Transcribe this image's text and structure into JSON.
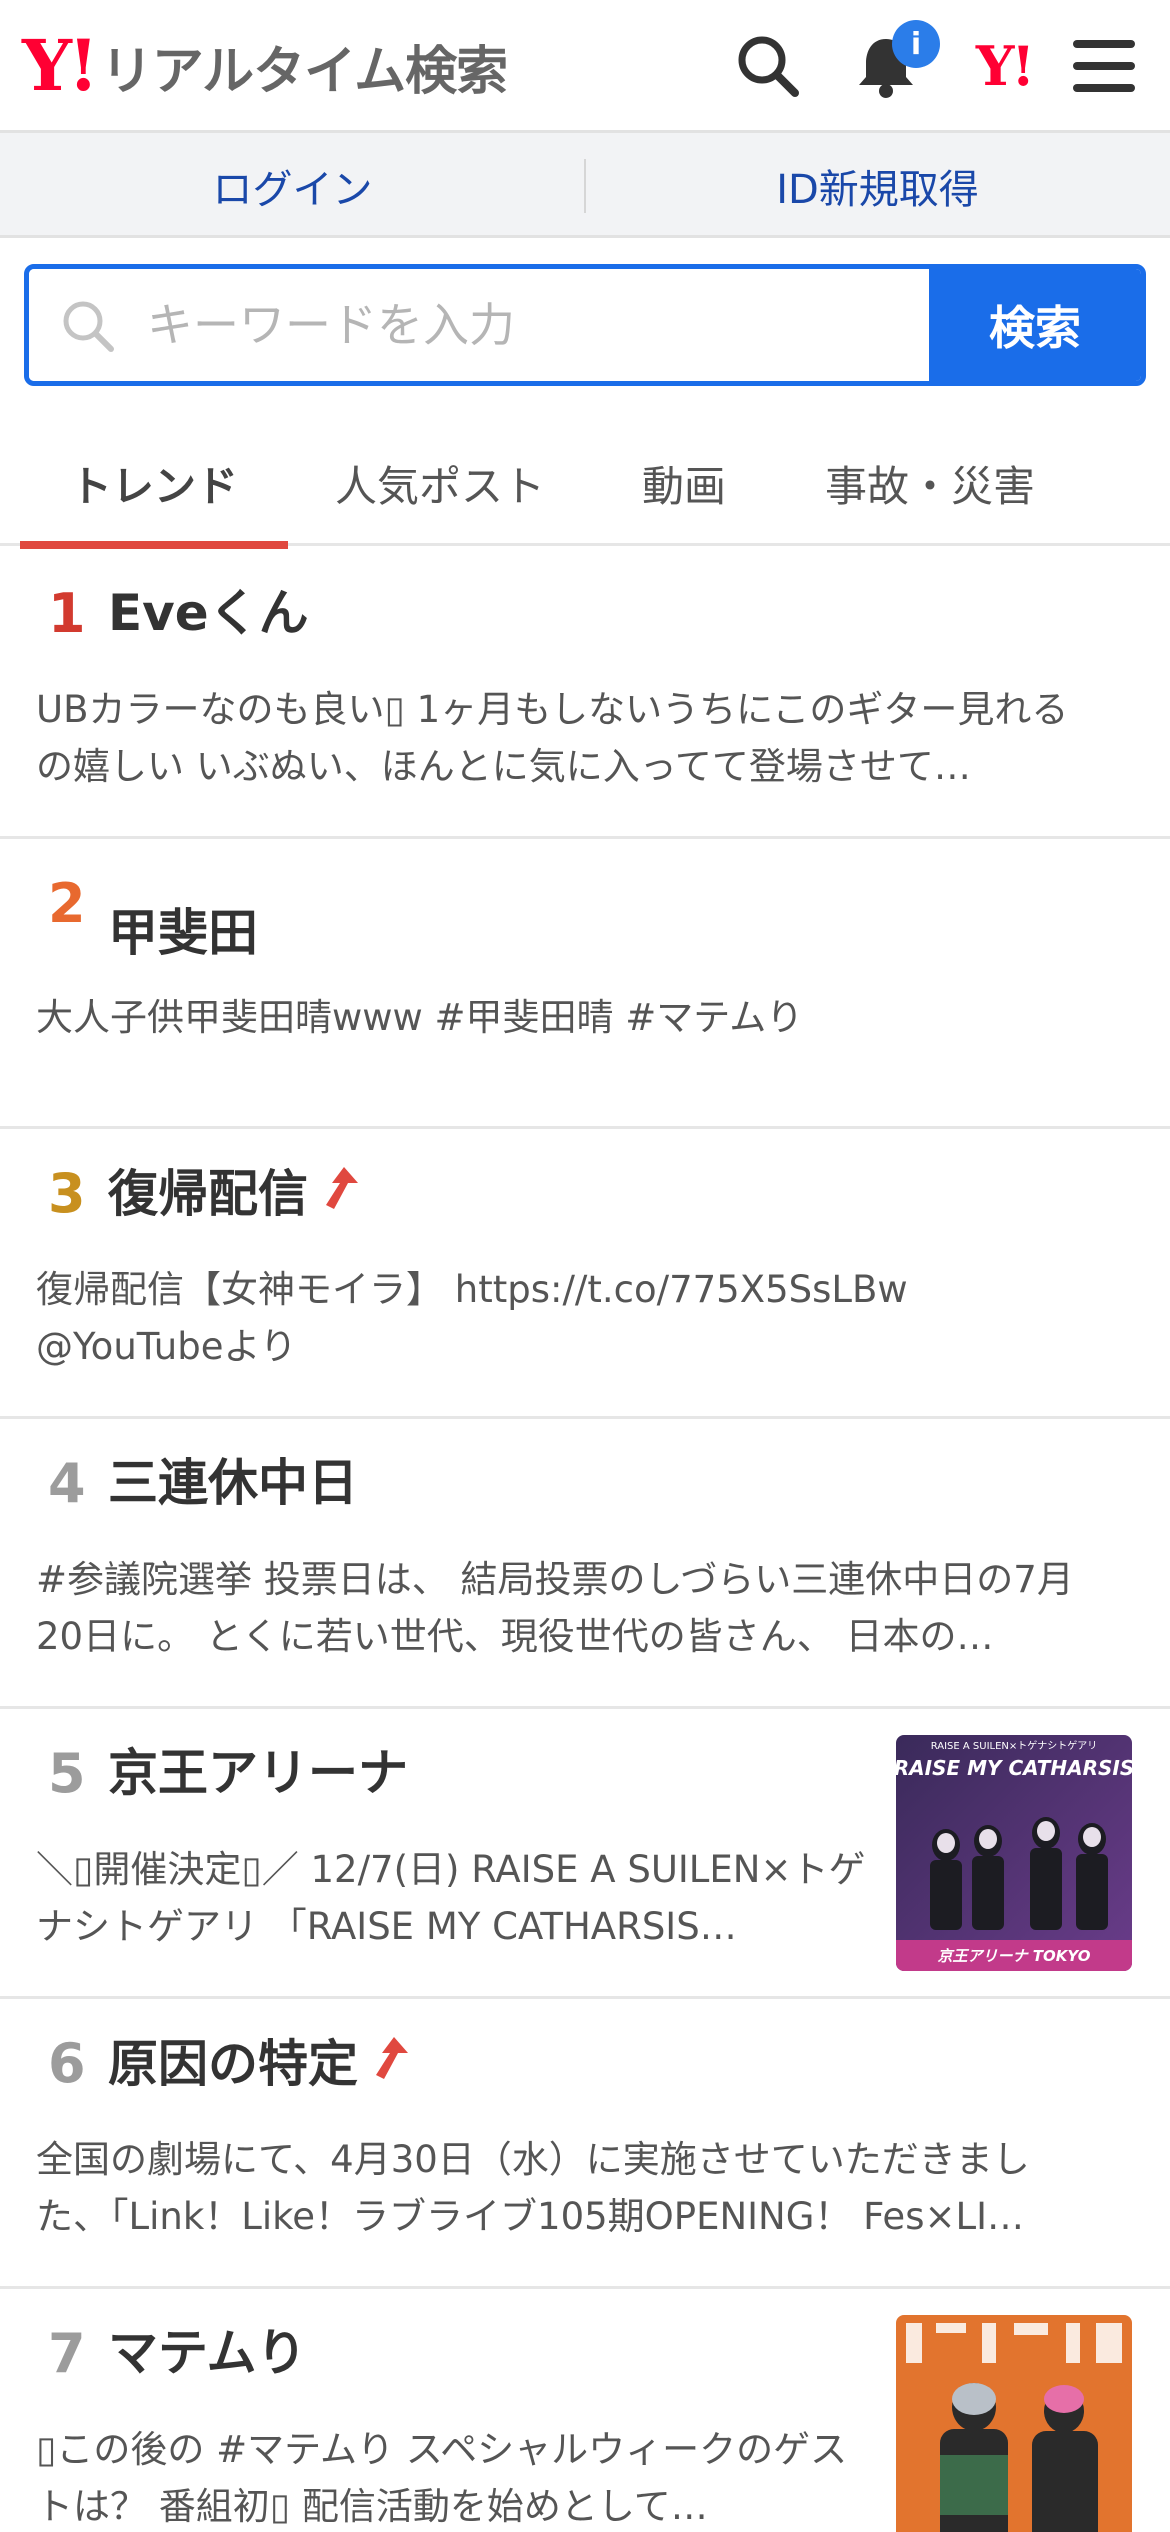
{
  "header": {
    "logo_mark": "Y!",
    "logo_text": "リアルタイム検索",
    "notification_count": "i",
    "yj_mark": "Y!"
  },
  "loginbar": {
    "login_label": "ログイン",
    "register_label": "ID新規取得"
  },
  "search": {
    "placeholder": "キーワードを入力",
    "button_label": "検索"
  },
  "tabs": [
    {
      "label": "トレンド",
      "active": true
    },
    {
      "label": "人気ポスト",
      "active": false
    },
    {
      "label": "動画",
      "active": false
    },
    {
      "label": "事故・災害",
      "active": false
    }
  ],
  "trends": [
    {
      "rank": "1",
      "term": "Eveくん",
      "rising": false,
      "has_thumb": false,
      "desc": "UBカラーなのも良い▯ 1ヶ月もしないうちにこのギター見れるの嬉しい いぶぬい、ほんとに気に入ってて登場させて…"
    },
    {
      "rank": "2",
      "term": "甲斐田",
      "rising": false,
      "has_thumb": false,
      "desc": "大人子供甲斐田晴www #甲斐田晴 #マテムり"
    },
    {
      "rank": "3",
      "term": "復帰配信",
      "rising": true,
      "has_thumb": false,
      "desc": "復帰配信【女神モイラ】 https://t.co/775X5SsLBw @YouTubeより"
    },
    {
      "rank": "4",
      "term": "三連休中日",
      "rising": false,
      "has_thumb": false,
      "desc": "#参議院選挙 投票日は、 結局投票のしづらい三連休中日の7月20日に。 とくに若い世代、現役世代の皆さん、 日本の…"
    },
    {
      "rank": "5",
      "term": "京王アリーナ",
      "rising": false,
      "has_thumb": true,
      "desc": "＼▯開催決定▯／ 12/7(日) RAISE A SUILEN×トゲナシトゲアリ 「RAISE MY CATHARSIS…",
      "thumb_top": "RAISE A SUILEN×トゲナシトゲアリ",
      "thumb_title": "RAISE MY CATHARSIS",
      "thumb_bottom": "京王アリーナ TOKYO"
    },
    {
      "rank": "6",
      "term": "原因の特定",
      "rising": true,
      "has_thumb": false,
      "desc": "全国の劇場にて、4月30日（水）に実施させていただきました、「Link！Like！ラブライブ105期OPENING！ Fes×LI…"
    },
    {
      "rank": "7",
      "term": "マテムり",
      "rising": false,
      "has_thumb": true,
      "desc": "▯この後の #マテムり スペシャルウィークのゲストは？ 番組初▯ 配信活動を始めとして…"
    }
  ],
  "colors": {
    "brand_red": "#ff0033",
    "accent_blue": "#1a6de9",
    "link_blue": "#1a48a9",
    "tab_underline": "#e0483f",
    "rising_arrow": "#e0483f"
  },
  "icons": {
    "search": "search-icon",
    "bell": "bell-icon",
    "menu": "hamburger-menu-icon",
    "rising": "rising-arrow-icon"
  }
}
